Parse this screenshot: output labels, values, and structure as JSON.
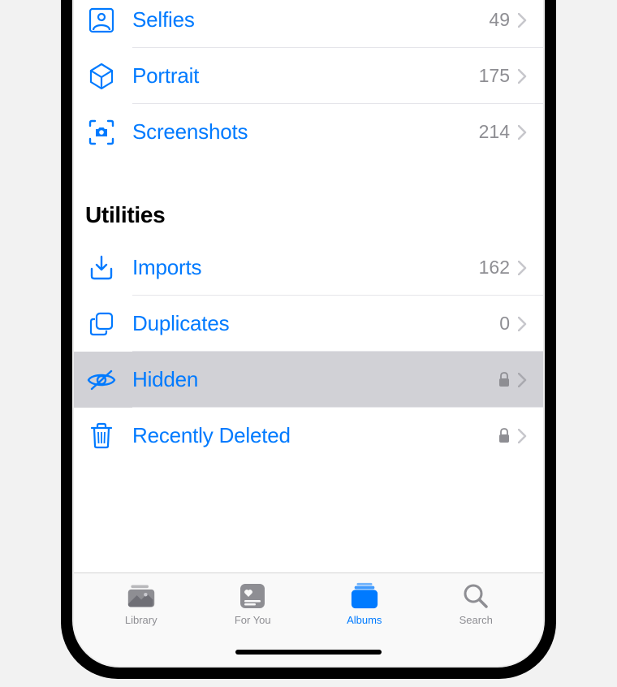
{
  "mediaTypes": {
    "items": [
      {
        "icon": "selfies",
        "label": "Selfies",
        "count": "49"
      },
      {
        "icon": "portrait",
        "label": "Portrait",
        "count": "175"
      },
      {
        "icon": "screenshots",
        "label": "Screenshots",
        "count": "214"
      }
    ]
  },
  "utilities": {
    "header": "Utilities",
    "items": [
      {
        "icon": "imports",
        "label": "Imports",
        "count": "162",
        "locked": false
      },
      {
        "icon": "duplicates",
        "label": "Duplicates",
        "count": "0",
        "locked": false
      },
      {
        "icon": "hidden",
        "label": "Hidden",
        "count": "",
        "locked": true,
        "selected": true
      },
      {
        "icon": "trash",
        "label": "Recently Deleted",
        "count": "",
        "locked": true
      }
    ]
  },
  "tabs": {
    "library": "Library",
    "forYou": "For You",
    "albums": "Albums",
    "search": "Search"
  }
}
